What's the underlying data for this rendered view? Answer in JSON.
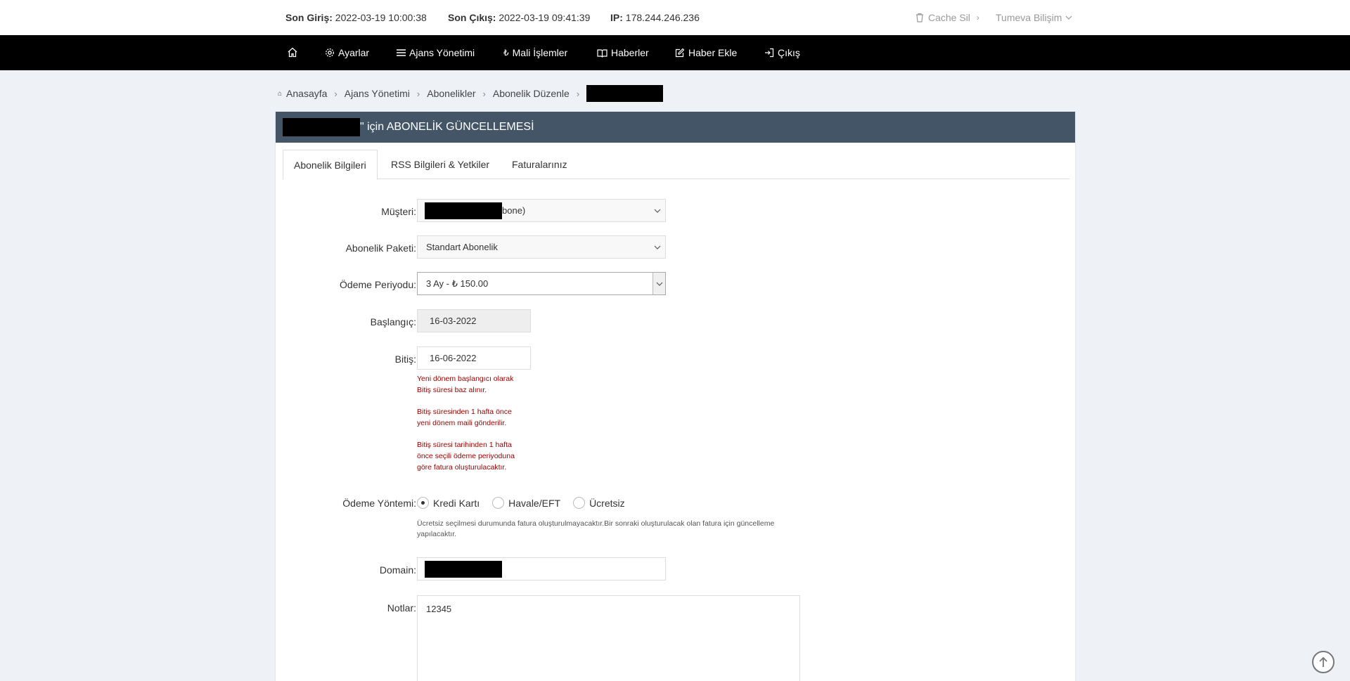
{
  "topbar": {
    "last_login_label": "Son Giriş:",
    "last_login_value": "2022-03-19 10:00:38",
    "last_logout_label": "Son Çıkış:",
    "last_logout_value": "2022-03-19 09:41:39",
    "ip_label": "IP:",
    "ip_value": "178.244.246.236",
    "cache_label": "Cache Sil",
    "company_label": "Tumeva Bilişim"
  },
  "nav": {
    "settings": "Ayarlar",
    "agency": "Ajans Yönetimi",
    "finance": "Mali İşlemler",
    "news": "Haberler",
    "add_news": "Haber Ekle",
    "logout": "Çıkış"
  },
  "breadcrumb": {
    "home": "Anasayfa",
    "agency": "Ajans Yönetimi",
    "subscriptions": "Abonelikler",
    "edit": "Abonelik Düzenle"
  },
  "panel": {
    "title_suffix": "\" için ABONELİK GÜNCELLEMESİ"
  },
  "tabs": {
    "info": "Abonelik Bilgileri",
    "rss": "RSS Bilgileri & Yetkiler",
    "invoices": "Faturalarınız"
  },
  "form": {
    "customer_label": "Müşteri:",
    "customer_value_suffix": "bone)",
    "package_label": "Abonelik Paketi:",
    "package_value": "Standart Abonelik",
    "period_label": "Ödeme Periyodu:",
    "period_value": "3 Ay - ₺ 150.00",
    "start_label": "Başlangıç:",
    "start_value": "16-03-2022",
    "end_label": "Bitiş:",
    "end_value": "16-06-2022",
    "end_help_1a": "Yeni dönem başlangıcı olarak",
    "end_help_1b": "Bitiş süresi baz alınır.",
    "end_help_2a": "Bitiş süresinden 1 hafta önce",
    "end_help_2b": "yeni dönem maili gönderilir.",
    "end_help_3a": "Bitiş süresi tarihinden 1 hafta",
    "end_help_3b": "önce seçili ödeme periyoduna",
    "end_help_3c": "göre fatura oluşturulacaktır.",
    "payment_label": "Ödeme Yöntemi:",
    "payment_options": [
      "Kredi Kartı",
      "Havale/EFT",
      "Ücretsiz"
    ],
    "payment_selected": "Kredi Kartı",
    "payment_help": "Ücretsiz seçilmesi durumunda fatura oluşturulmayacaktır.Bir sonraki oluşturulacak olan fatura için güncelleme yapılacaktır.",
    "domain_label": "Domain:",
    "notes_label": "Notlar:",
    "notes_value": "12345"
  }
}
